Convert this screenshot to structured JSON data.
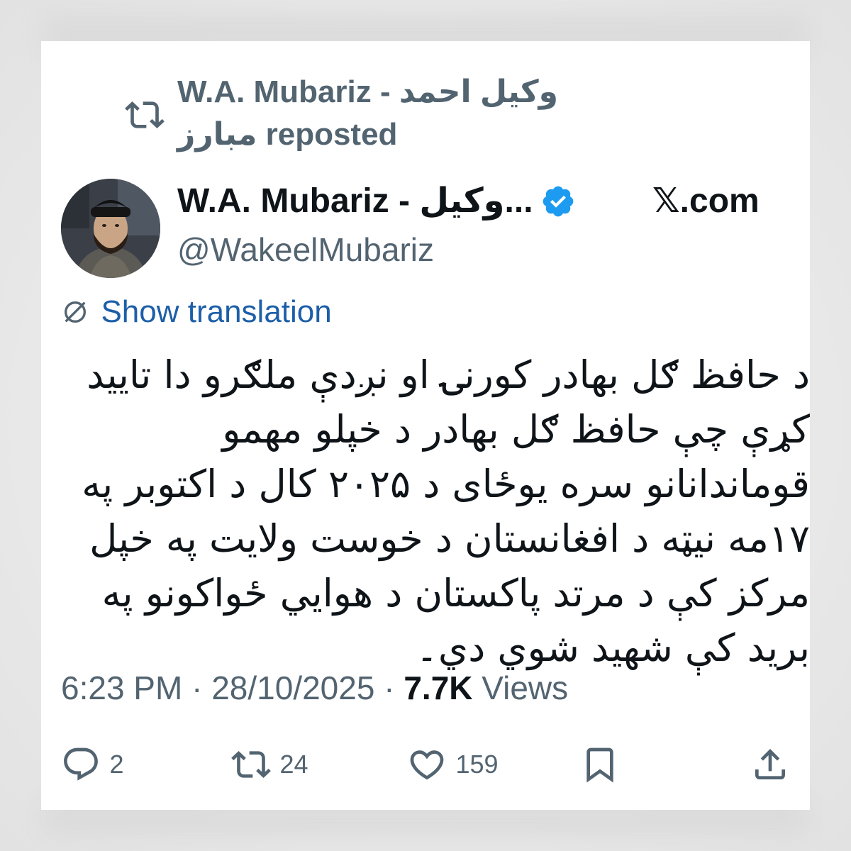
{
  "repost": {
    "line1": "W.A. Mubariz - وکیل احمد",
    "line2": "مبارز reposted",
    "icon": "repost-icon"
  },
  "author": {
    "display_name": "W.A. Mubariz - وکیل...",
    "handle": "@WakeelMubariz",
    "verified": true,
    "avatar": "profile-photo"
  },
  "brand": {
    "label": "𝕏.com"
  },
  "translation": {
    "label": "Show translation",
    "icon": "globe-icon"
  },
  "tweet": {
    "text": "د حافظ ګل بهادر کورنۍ او نږدې ملګرو دا تایید کړې چې حافظ ګل بهادر د خپلو مهمو قوماندانانو سره یوځای د ۲۰۲۵ کال د اکتوبر په ۱۷مه نیټه د افغانستان د خوست ولایت په خپل مرکز کې د مرتد پاکستان د هوایي ځواکونو په برید کې شهید شوي دي۔",
    "time": "6:23 PM",
    "date": "28/10/2025",
    "views_count": "7.7K",
    "views_label": "Views",
    "separator": "·"
  },
  "actions": {
    "replies": "2",
    "reposts": "24",
    "likes": "159"
  },
  "colors": {
    "accent": "#1d5fa8",
    "verified": "#1d9bf0",
    "muted": "#536471",
    "text": "#0f1419"
  }
}
